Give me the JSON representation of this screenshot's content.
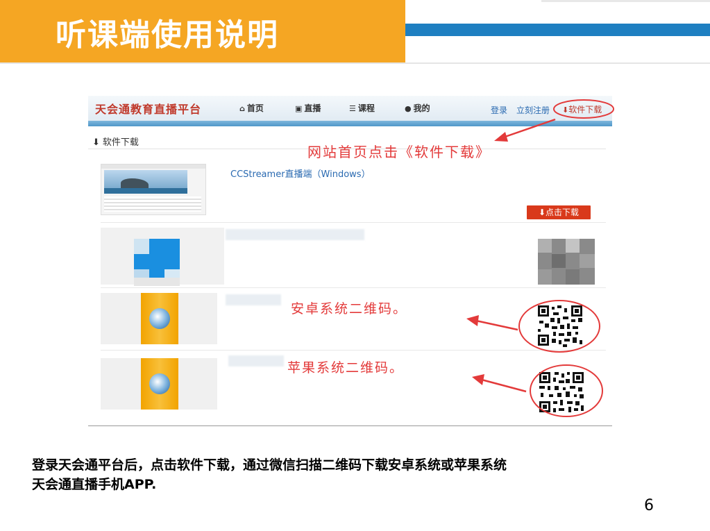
{
  "slide": {
    "title": "听课端使用说明",
    "caption_line1": "登录天会通平台后，点击软件下载，通过微信扫描二维码下载安卓系统或苹果系统",
    "caption_line2": "天会通直播手机APP.",
    "page_number": "6",
    "colors": {
      "banner": "#F5A623",
      "blue_bar": "#1E7FC1",
      "annotation": "#e33a3a"
    }
  },
  "site": {
    "brand": "天会通教育直播平台",
    "nav": [
      {
        "icon": "home-icon",
        "label": "首页"
      },
      {
        "icon": "tv-icon",
        "label": "直播"
      },
      {
        "icon": "list-icon",
        "label": "课程"
      },
      {
        "icon": "user-icon",
        "label": "我的"
      }
    ],
    "login": "登录",
    "register": "立刻注册",
    "software_download": "软件下载"
  },
  "page": {
    "section_title": "软件下载",
    "item1_title": "CCStreamer直播端（Windows）",
    "item1_button": "点击下载"
  },
  "annotations": {
    "homepage_hint": "网站首页点击《软件下载》",
    "android_qr": "安卓系统二维码。",
    "ios_qr": "苹果系统二维码。"
  }
}
